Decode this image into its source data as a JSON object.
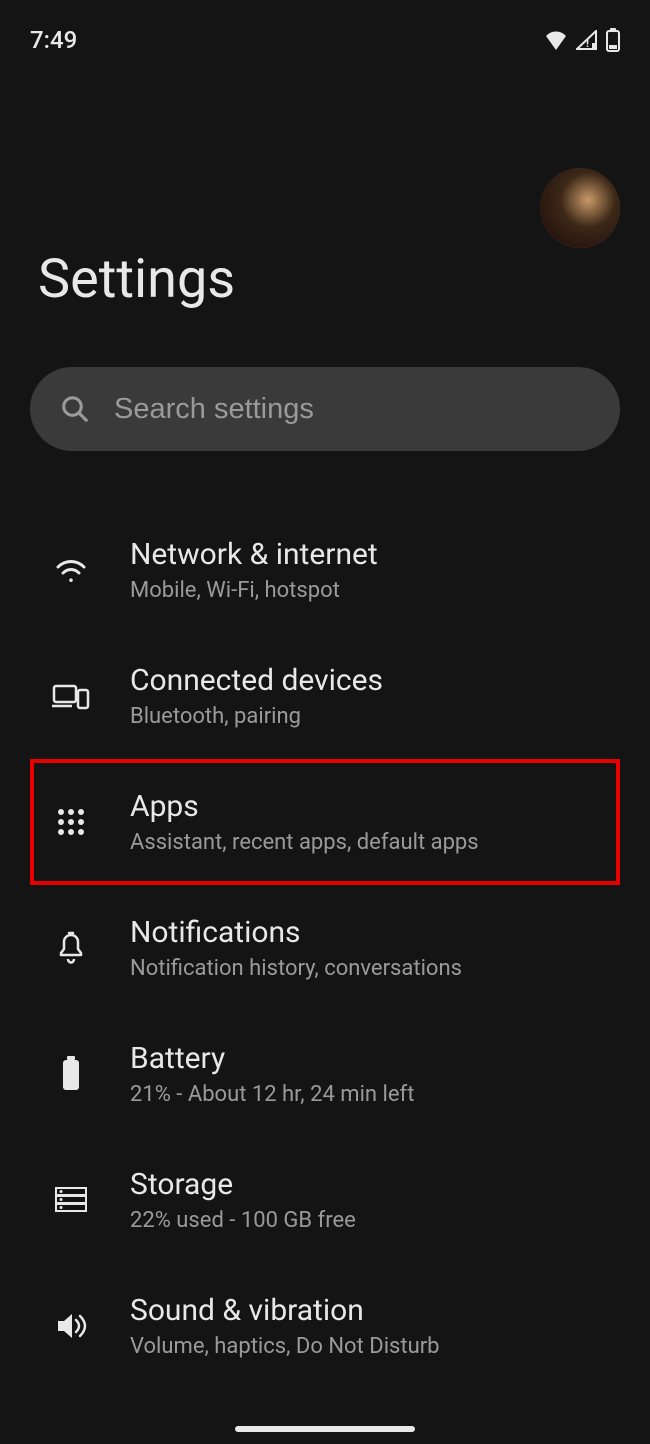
{
  "status": {
    "time": "7:49"
  },
  "header": {
    "title": "Settings"
  },
  "search": {
    "placeholder": "Search settings"
  },
  "items": [
    {
      "title": "Network & internet",
      "subtitle": "Mobile, Wi-Fi, hotspot",
      "icon": "wifi-icon",
      "highlighted": false
    },
    {
      "title": "Connected devices",
      "subtitle": "Bluetooth, pairing",
      "icon": "devices-icon",
      "highlighted": false
    },
    {
      "title": "Apps",
      "subtitle": "Assistant, recent apps, default apps",
      "icon": "apps-icon",
      "highlighted": true
    },
    {
      "title": "Notifications",
      "subtitle": "Notification history, conversations",
      "icon": "bell-icon",
      "highlighted": false
    },
    {
      "title": "Battery",
      "subtitle": "21% - About 12 hr, 24 min left",
      "icon": "battery-icon",
      "highlighted": false
    },
    {
      "title": "Storage",
      "subtitle": "22% used - 100 GB free",
      "icon": "storage-icon",
      "highlighted": false
    },
    {
      "title": "Sound & vibration",
      "subtitle": "Volume, haptics, Do Not Disturb",
      "icon": "sound-icon",
      "highlighted": false
    }
  ]
}
